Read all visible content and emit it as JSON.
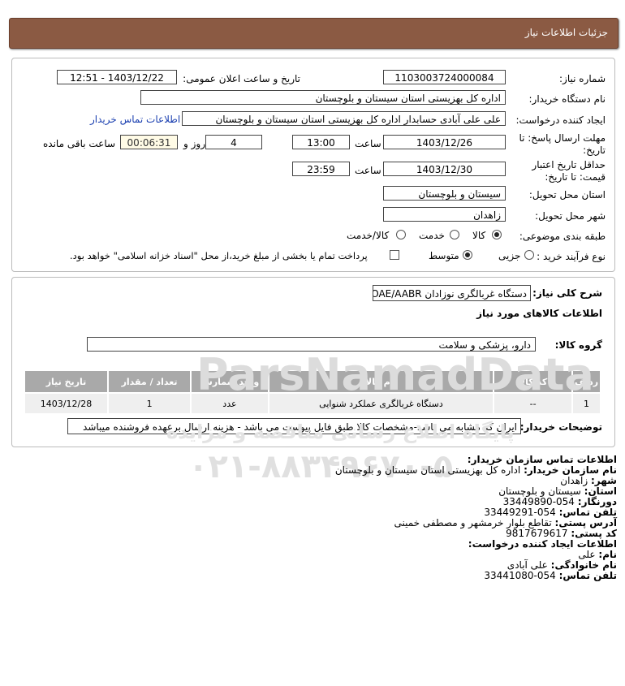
{
  "header": {
    "title": "جزئیات اطلاعات نیاز"
  },
  "form": {
    "need_number_label": "شماره نیاز:",
    "need_number": "1103003724000084",
    "announce_label": "تاریخ و ساعت اعلان عمومی:",
    "announce_value": "1403/12/22 - 12:51",
    "buyer_label": "نام دستگاه خریدار:",
    "buyer_value": "اداره کل بهزیستی استان سیستان و بلوچستان",
    "creator_label": "ایجاد کننده درخواست:",
    "creator_value": "علی علی آبادی حسابدار اداره کل بهزیستی استان سیستان و بلوچستان",
    "contact_link": "اطلاعات تماس خریدار",
    "deadline_label_1": "مهلت ارسال پاسخ: تا",
    "deadline_label_2": "تاریخ:",
    "deadline_date": "1403/12/26",
    "time_label": "ساعت",
    "deadline_time": "13:00",
    "days_value": "4",
    "days_label": "روز و",
    "remaining_value": "00:06:31",
    "remaining_label": "ساعت باقی مانده",
    "validity_label_1": "حداقل تاریخ اعتبار",
    "validity_label_2": "قیمت: تا تاریخ:",
    "validity_date": "1403/12/30",
    "validity_time": "23:59",
    "province_label": "استان محل تحویل:",
    "province_value": "سیستان و بلوچستان",
    "city_label": "شهر محل تحویل:",
    "city_value": "زاهدان",
    "category_label": "طبقه بندی موضوعی:",
    "category_options": [
      "کالا",
      "خدمت",
      "کالا/خدمت"
    ],
    "process_label": "نوع فرآیند خرید :",
    "process_options": [
      "جزیی",
      "متوسط"
    ],
    "payment_note": "پرداخت تمام یا بخشی از مبلغ خرید،از محل \"اسناد خزانه اسلامی\" خواهد بود."
  },
  "details": {
    "general_desc_label": "شرح کلی نیاز:",
    "general_desc_value": "دستگاه غربالگری نوزادان OAE/AABR",
    "goods_info_title": "اطلاعات کالاهای مورد نیاز",
    "goods_group_label": "گروه کالا:",
    "goods_group_value": "دارو، پزشکی و سلامت",
    "table": {
      "headers": [
        "ردیف",
        "کد کالا",
        "نام کالا",
        "واحد شمارش",
        "تعداد / مقدار",
        "تاریخ نیاز"
      ],
      "rows": [
        [
          "1",
          "--",
          "دستگاه غربالگری عملکرد شنوایی",
          "عدد",
          "1",
          "1403/12/28"
        ]
      ]
    },
    "buyer_notes_label": "توضیحات خریدار:",
    "buyer_notes_value": "ایران کد مشابه می باشد-مشخصات کالا طبق فایل پیوست می باشد - هزینه ارسال برعهده فروشنده میباشد"
  },
  "contact": {
    "title": "اطلاعات تماس سازمان خریدار:",
    "org_label": "نام سازمان خریدار:",
    "org_value": "اداره کل بهزیستی استان سیستان و بلوچستان",
    "city_label": "شهر:",
    "city_value": "زاهدان",
    "province_label": "استان:",
    "province_value": "سیستان و بلوچستان",
    "fax_label": "دورنگار:",
    "fax_value": "054-33449890",
    "phone_label": "تلفن تماس:",
    "phone_value": "054-33449291",
    "address_label": "آدرس پستی:",
    "address_value": "تقاطع بلوار خرمشهر و مصطفی خمینی",
    "postal_label": "کد پستی:",
    "postal_value": "9817679617",
    "creator_title": "اطلاعات ایجاد کننده درخواست:",
    "name_label": "نام:",
    "name_value": "علی",
    "family_label": "نام خانوادگی:",
    "family_value": "علی آبادی",
    "creator_phone_label": "تلفن تماس:",
    "creator_phone_value": "054-33441080"
  },
  "watermark": {
    "brand": "ParsNamadData",
    "line1": "پایگاه اطلاع رسانی مناقصه و مزایده",
    "phone": "۰۲۱-۸۸۳۴۹۶۷۰-۵"
  }
}
